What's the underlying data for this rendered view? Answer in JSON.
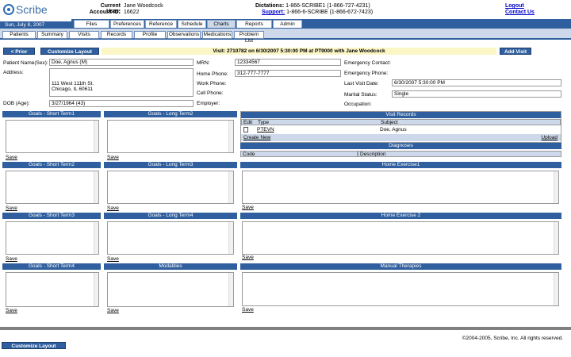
{
  "header": {
    "logo_text": "Scribe",
    "current_user_label": "Current User:",
    "current_user": "Jane Woodcock",
    "account_label": "Account ID:",
    "account_id": "16622",
    "dictations_label": "Dictations:",
    "dictations_value": "1-866-SCRIBE1 (1-866-727-4231)",
    "support_label": "Support:",
    "support_value": "1-866-6-SCRIBE (1-866-672-7423)",
    "logout": "Logout",
    "contact_us": "Contact Us"
  },
  "date": "Sun, July 8, 2007",
  "top_tabs": [
    "Files",
    "Preferences",
    "Reference",
    "Schedule",
    "Charts",
    "Reports",
    "Admin"
  ],
  "sub_tabs": [
    "Patients",
    "Summary",
    "Visits",
    "Records",
    "Profile",
    "Observations",
    "Medications",
    "Problem List"
  ],
  "toolbar": {
    "prior": "< Prior",
    "customize": "Customize Layout",
    "visit_info": "Visit: 2710782 on 6/30/2007 5:30:00 PM at PT9000 with Jane Woodcock",
    "add_visit": "Add Visit"
  },
  "patient": {
    "name_label": "Patient Name(Sex):",
    "name_value": "Doe, Agnus (M)",
    "address_label": "Address:",
    "address_line1": "111 West 111th St.",
    "address_line2": "Chicago, IL 60611",
    "dob_label": "DOB (Age):",
    "dob_value": "3/27/1964 (43)",
    "mrn_label": "MRN:",
    "mrn_value": "12334567",
    "home_phone_label": "Home Phone:",
    "home_phone_value": "312-777-7777",
    "work_phone_label": "Work Phone:",
    "cell_phone_label": "Cell Phone:",
    "employer_label": "Employer:",
    "emergency_contact_label": "Emergency Contact:",
    "emergency_phone_label": "Emergency Phone:",
    "last_visit_label": "Last Visit Date:",
    "last_visit_value": "6/30/2007 5:30:00 PM",
    "marital_label": "Marital Status:",
    "marital_value": "Single",
    "occupation_label": "Occupation:"
  },
  "panels": {
    "gst1": "Goals - Short Term1",
    "glt2": "Goals - Long Term2",
    "gst2": "Goals - Short Term2",
    "glt3": "Goals - Long Term3",
    "gst3": "Goals - Short Term3",
    "glt4": "Goals - Long Term4",
    "gst4": "Goals - Short Term4",
    "modalities": "Modalities",
    "visit_records": "Visit Records",
    "diagnoses": "Diagnoses",
    "home_ex1": "Home Exercise1",
    "home_ex2": "Home Exercise 2",
    "manual": "Manual Therapies"
  },
  "save_label": "Save",
  "visit_records": {
    "col_edit": "Edit",
    "col_type": "Type",
    "col_subject": "Subject",
    "row_type": "PTEVN",
    "row_subject": "Doe, Agnus",
    "create_new": "Create New",
    "upload": "Upload"
  },
  "diagnoses": {
    "col_code": "Code",
    "col_desc": "Description"
  },
  "footer": {
    "copyright": "©2004-2005, Scribe, Inc. All rights reserved.",
    "customize": "Customize Layout"
  }
}
